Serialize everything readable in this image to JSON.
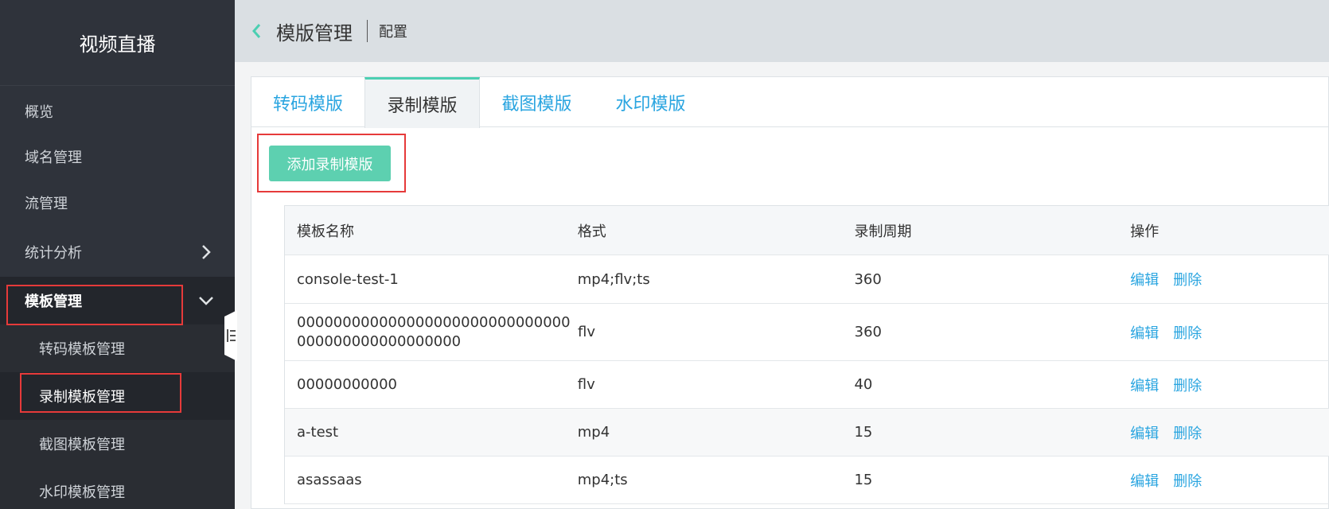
{
  "sidebar": {
    "title": "视频直播",
    "items": [
      {
        "label": "概览"
      },
      {
        "label": "域名管理"
      },
      {
        "label": "流管理"
      },
      {
        "label": "统计分析"
      },
      {
        "label": "模板管理"
      }
    ],
    "sub_items": [
      {
        "label": "转码模板管理"
      },
      {
        "label": "录制模板管理"
      },
      {
        "label": "截图模板管理"
      },
      {
        "label": "水印模板管理"
      }
    ]
  },
  "header": {
    "title": "模版管理",
    "crumb": "配置"
  },
  "tabs": [
    {
      "label": "转码模版"
    },
    {
      "label": "录制模版"
    },
    {
      "label": "截图模版"
    },
    {
      "label": "水印模版"
    }
  ],
  "add_button": "添加录制模版",
  "table": {
    "columns": [
      "模板名称",
      "格式",
      "录制周期",
      "操作"
    ],
    "rows": [
      {
        "name": "console-test-1",
        "format": "mp4;flv;ts",
        "period": "360"
      },
      {
        "name": "000000000000000000000000000000000000000000000000",
        "name_line1": "000000000000000000000000000000",
        "name_line2": "000000000000000000",
        "format": "flv",
        "period": "360"
      },
      {
        "name": "00000000000",
        "format": "flv",
        "period": "40"
      },
      {
        "name": "a-test",
        "format": "mp4",
        "period": "15"
      },
      {
        "name": "asassaas",
        "format": "mp4;ts",
        "period": "15"
      }
    ],
    "edit_label": "编辑",
    "delete_label": "删除"
  },
  "colors": {
    "accent": "#5dd0b0",
    "link": "#2aa5e0",
    "sidebar_bg": "#2f333b",
    "highlight": "#e63a3a"
  }
}
